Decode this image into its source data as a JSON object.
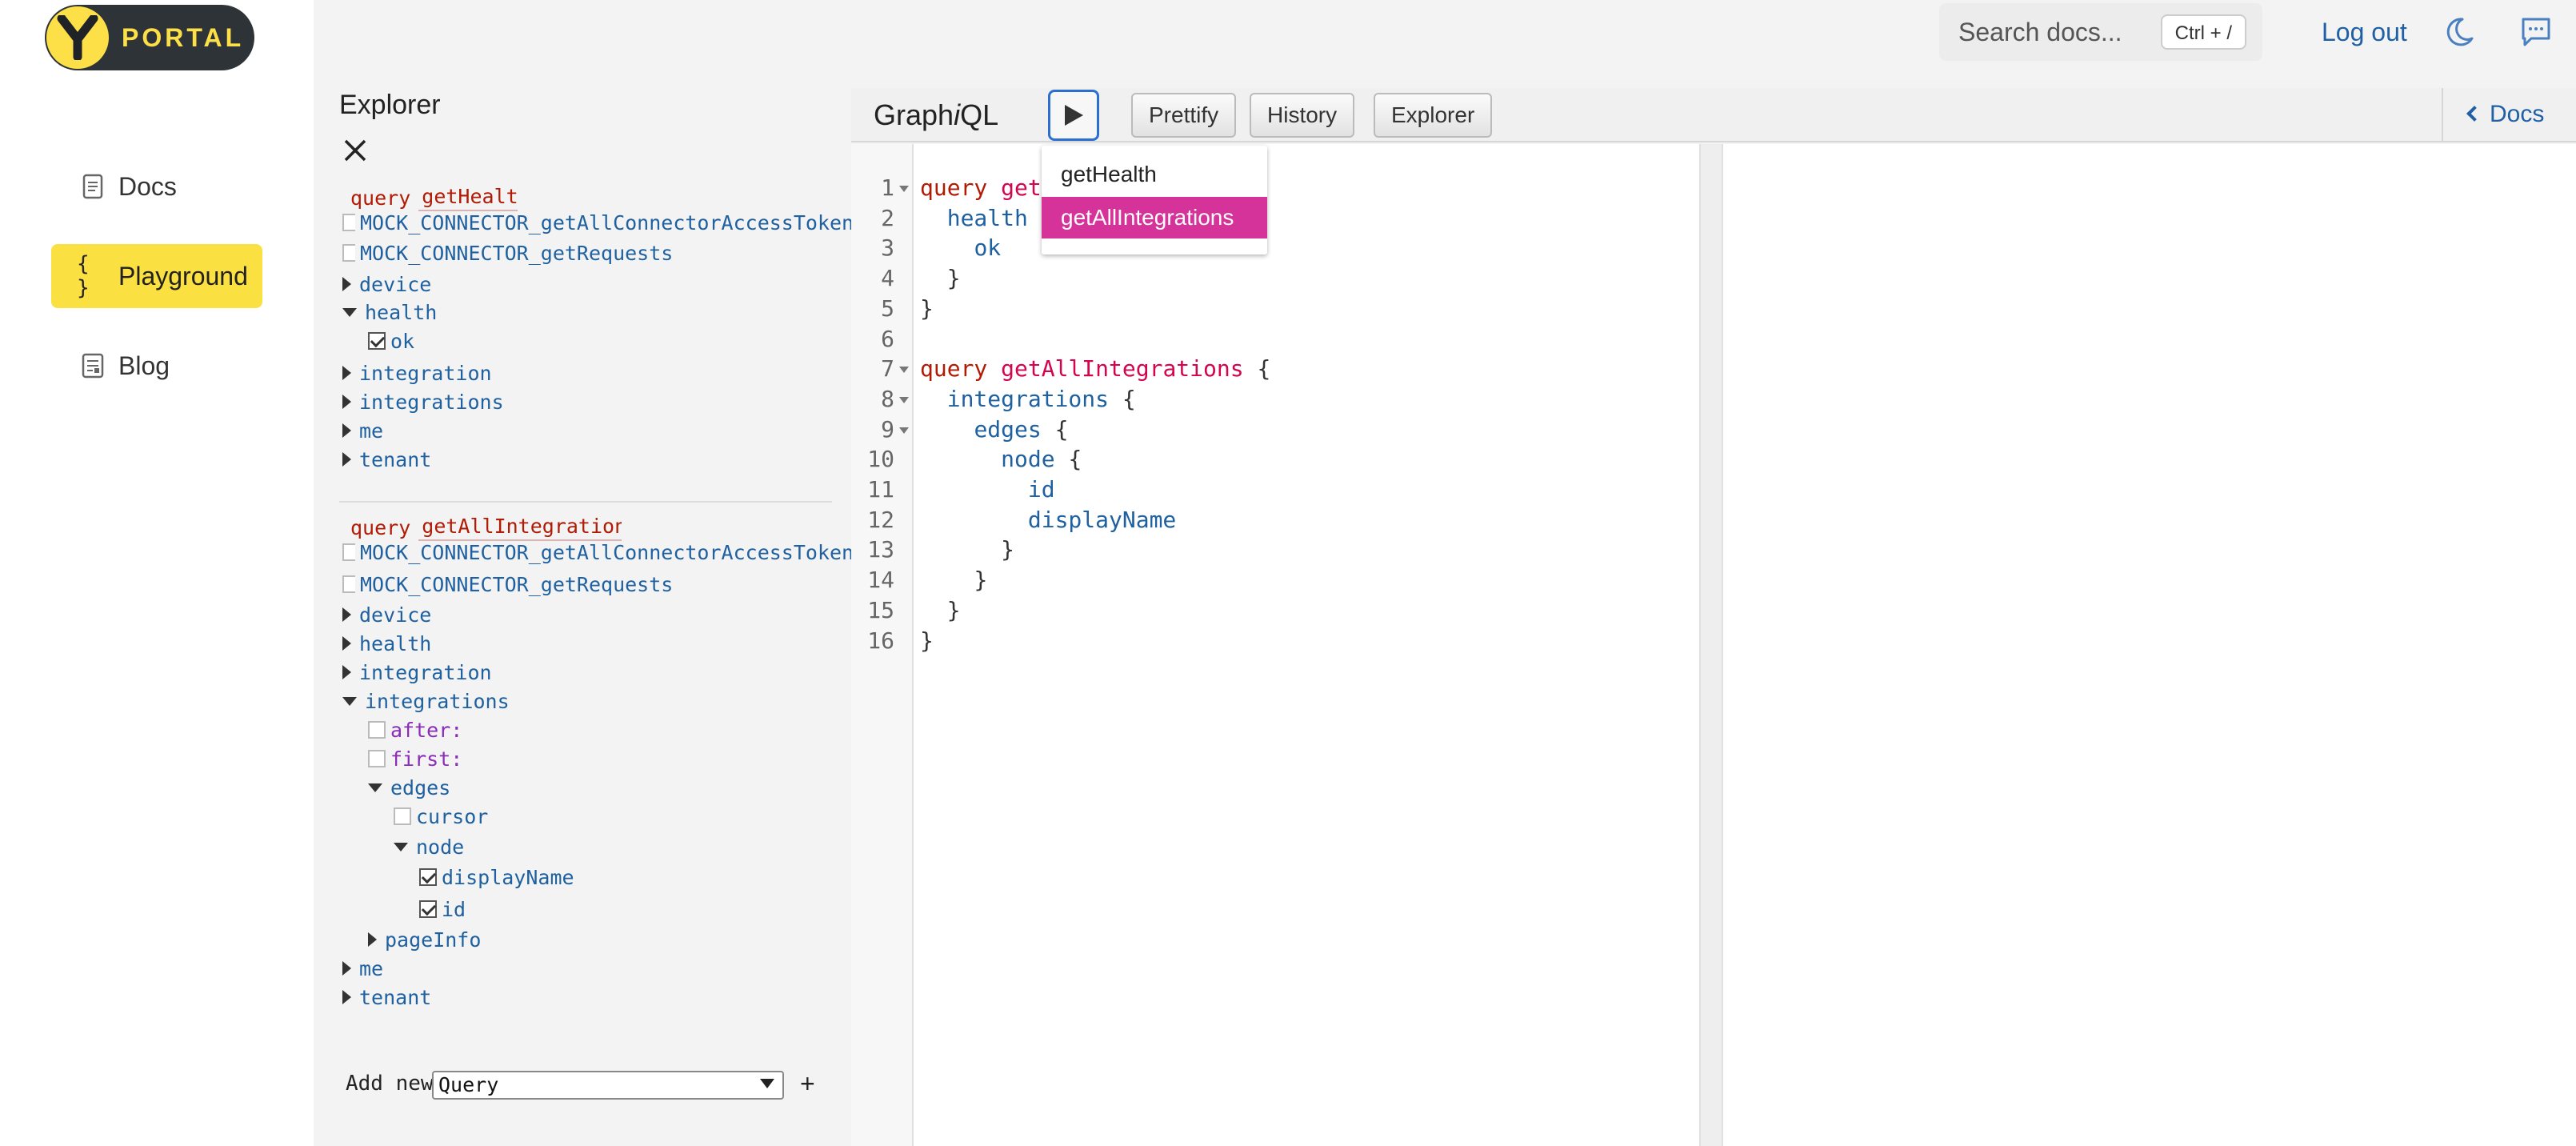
{
  "brand": {
    "logo_text": "PORTAL",
    "accent": "#fbe041",
    "logo_bg": "#2e3338"
  },
  "sidebar": {
    "items": [
      {
        "label": "Docs",
        "icon": "document-icon",
        "active": false
      },
      {
        "label": "Playground",
        "icon": "braces-icon",
        "active": true
      },
      {
        "label": "Blog",
        "icon": "blog-icon",
        "active": false
      }
    ]
  },
  "topbar": {
    "search_placeholder": "Search docs...",
    "search_shortcut": "Ctrl + /",
    "logout_label": "Log out"
  },
  "explorer": {
    "title": "Explorer",
    "operations": [
      {
        "keyword": "query",
        "name": "getHealth",
        "rows": [
          {
            "label": "MOCK_CONNECTOR_getAllConnectorAccessToken",
            "kind": "checkbox",
            "checked": false
          },
          {
            "label": "MOCK_CONNECTOR_getRequests",
            "kind": "checkbox",
            "checked": false
          },
          {
            "label": "device",
            "kind": "collapsed"
          },
          {
            "label": "health",
            "kind": "expanded"
          },
          {
            "label": "ok",
            "kind": "checkbox",
            "checked": true
          },
          {
            "label": "integration",
            "kind": "collapsed"
          },
          {
            "label": "integrations",
            "kind": "collapsed"
          },
          {
            "label": "me",
            "kind": "collapsed"
          },
          {
            "label": "tenant",
            "kind": "collapsed"
          }
        ]
      },
      {
        "keyword": "query",
        "name": "getAllIntegrations",
        "rows": [
          {
            "label": "MOCK_CONNECTOR_getAllConnectorAccessToken",
            "kind": "checkbox",
            "checked": false
          },
          {
            "label": "MOCK_CONNECTOR_getRequests",
            "kind": "checkbox",
            "checked": false
          },
          {
            "label": "device",
            "kind": "collapsed"
          },
          {
            "label": "health",
            "kind": "collapsed"
          },
          {
            "label": "integration",
            "kind": "collapsed"
          },
          {
            "label": "integrations",
            "kind": "expanded"
          },
          {
            "label": "after:",
            "kind": "arg"
          },
          {
            "label": "first:",
            "kind": "arg"
          },
          {
            "label": "edges",
            "kind": "expanded"
          },
          {
            "label": "cursor",
            "kind": "checkbox",
            "checked": false
          },
          {
            "label": "node",
            "kind": "expanded"
          },
          {
            "label": "displayName",
            "kind": "checkbox",
            "checked": true
          },
          {
            "label": "id",
            "kind": "checkbox",
            "checked": true
          },
          {
            "label": "pageInfo",
            "kind": "collapsed"
          },
          {
            "label": "me",
            "kind": "collapsed"
          },
          {
            "label": "tenant",
            "kind": "collapsed"
          }
        ]
      }
    ],
    "add_new_label": "Add new",
    "add_new_selected": "Query",
    "add_plus": "+"
  },
  "toolbar": {
    "title_pre": "Graph",
    "title_i": "i",
    "title_post": "QL",
    "prettify_label": "Prettify",
    "history_label": "History",
    "explorer_label": "Explorer",
    "docs_label": "Docs"
  },
  "run_menu": {
    "items": [
      "getHealth",
      "getAllIntegrations"
    ],
    "selected_index": 1
  },
  "editor": {
    "lines": [
      {
        "n": "1",
        "fold": true,
        "indent": 0,
        "tokens": [
          [
            "kw",
            "query"
          ],
          [
            "",
            " "
          ],
          [
            "def",
            "getH"
          ]
        ]
      },
      {
        "n": "2",
        "fold": false,
        "indent": 1,
        "tokens": [
          [
            "prop",
            "health"
          ],
          [
            "",
            " {"
          ]
        ]
      },
      {
        "n": "3",
        "fold": false,
        "indent": 2,
        "tokens": [
          [
            "prop",
            "ok"
          ]
        ]
      },
      {
        "n": "4",
        "fold": false,
        "indent": 1,
        "tokens": [
          [
            "",
            "}"
          ]
        ]
      },
      {
        "n": "5",
        "fold": false,
        "indent": 0,
        "tokens": [
          [
            "",
            "}"
          ]
        ]
      },
      {
        "n": "6",
        "fold": false,
        "indent": 0,
        "tokens": []
      },
      {
        "n": "7",
        "fold": true,
        "indent": 0,
        "tokens": [
          [
            "kw",
            "query"
          ],
          [
            "",
            " "
          ],
          [
            "def",
            "getAllIntegrations"
          ],
          [
            "",
            " {"
          ]
        ]
      },
      {
        "n": "8",
        "fold": true,
        "indent": 1,
        "tokens": [
          [
            "prop",
            "integrations"
          ],
          [
            "",
            " {"
          ]
        ]
      },
      {
        "n": "9",
        "fold": true,
        "indent": 2,
        "tokens": [
          [
            "prop",
            "edges"
          ],
          [
            "",
            " {"
          ]
        ]
      },
      {
        "n": "10",
        "fold": false,
        "indent": 3,
        "tokens": [
          [
            "prop",
            "node"
          ],
          [
            "",
            " {"
          ]
        ]
      },
      {
        "n": "11",
        "fold": false,
        "indent": 4,
        "tokens": [
          [
            "prop",
            "id"
          ]
        ]
      },
      {
        "n": "12",
        "fold": false,
        "indent": 4,
        "tokens": [
          [
            "prop",
            "displayName"
          ]
        ]
      },
      {
        "n": "13",
        "fold": false,
        "indent": 3,
        "tokens": [
          [
            "",
            "}"
          ]
        ]
      },
      {
        "n": "14",
        "fold": false,
        "indent": 2,
        "tokens": [
          [
            "",
            "}"
          ]
        ]
      },
      {
        "n": "15",
        "fold": false,
        "indent": 1,
        "tokens": [
          [
            "",
            "}"
          ]
        ]
      },
      {
        "n": "16",
        "fold": false,
        "indent": 0,
        "tokens": [
          [
            "",
            "}"
          ]
        ]
      }
    ]
  }
}
